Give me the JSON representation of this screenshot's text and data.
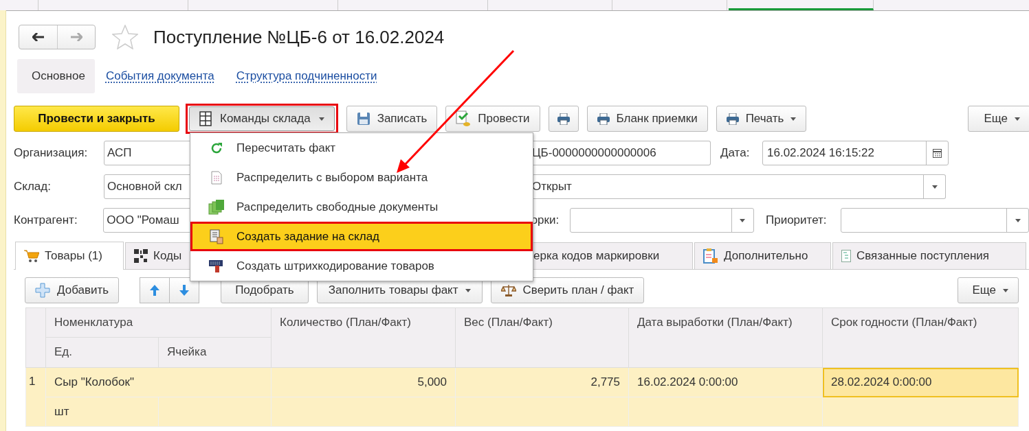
{
  "nav": {
    "back_disabled": false,
    "forward_disabled": true
  },
  "title": "Поступление №ЦБ-6 от 16.02.2024",
  "form_sections": [
    {
      "label": "Основное",
      "selected": true
    },
    {
      "label": "События документа",
      "selected": false
    },
    {
      "label": "Структура подчиненности",
      "selected": false
    }
  ],
  "toolbar": [
    {
      "kind": "primary",
      "label": "Провести и закрыть"
    },
    {
      "kind": "dropdown",
      "label": "Команды склада",
      "highlighted": true
    },
    {
      "kind": "button",
      "label": "Записать"
    },
    {
      "kind": "button",
      "label": "Провести"
    },
    {
      "kind": "icon"
    },
    {
      "kind": "button",
      "label": "Бланк приемки"
    },
    {
      "kind": "dropdown",
      "label": "Печать"
    },
    {
      "kind": "more",
      "label": "Еще"
    }
  ],
  "fields": {
    "organization": {
      "label": "Организация:",
      "value": "АСП"
    },
    "number": {
      "value": "ЦБ-0000000000000006"
    },
    "date": {
      "label": "Дата:",
      "value": "16.02.2024 16:15:22"
    },
    "warehouse": {
      "label": "Склад:",
      "value": "Основной скл"
    },
    "status": {
      "value": "Открыт"
    },
    "counterparty": {
      "label": "Контрагент:",
      "value": "ООО \"Ромаш"
    },
    "assembly": {
      "label": "орки:"
    },
    "priority": {
      "label": "Приоритет:"
    }
  },
  "tabs": [
    {
      "label": "Товары (1)",
      "selected": true
    },
    {
      "label": "Коды",
      "selected": false
    },
    {
      "label": "ерка кодов маркировки",
      "selected": false
    },
    {
      "label": "Дополнительно",
      "selected": false
    },
    {
      "label": "Связанные поступления",
      "selected": false
    }
  ],
  "table_toolbar": [
    {
      "kind": "add",
      "label": "Добавить"
    },
    {
      "kind": "arrows"
    },
    {
      "kind": "button",
      "label": "Подобрать"
    },
    {
      "kind": "dropdown",
      "label": "Заполнить товары факт"
    },
    {
      "kind": "scales",
      "label": "Сверить план / факт"
    },
    {
      "kind": "more",
      "label": "Еще"
    }
  ],
  "table": {
    "columns": [
      "Номенклатура",
      "Количество (План/Факт)",
      "Вес (План/Факт)",
      "Дата выработки (План/Факт)",
      "Срок годности (План/Факт)"
    ],
    "subcolumns": [
      "Ед.",
      "Ячейка"
    ],
    "rows": [
      {
        "number": "1",
        "item": "Сыр \"Колобок\"",
        "unit": "шт",
        "quantity": "5,000",
        "weight": "2,775",
        "production_date": "16.02.2024 0:00:00",
        "expiry_date": "28.02.2024 0:00:00",
        "selected": true
      }
    ]
  },
  "menu": {
    "items": [
      {
        "label": "Пересчитать факт",
        "selected": false
      },
      {
        "label": "Распределить с выбором варианта",
        "selected": false
      },
      {
        "label": "Распределить свободные документы",
        "selected": false
      },
      {
        "label": "Создать задание на склад",
        "selected": true
      },
      {
        "label": "Создать штрихкодирование товаров",
        "selected": false
      }
    ]
  }
}
